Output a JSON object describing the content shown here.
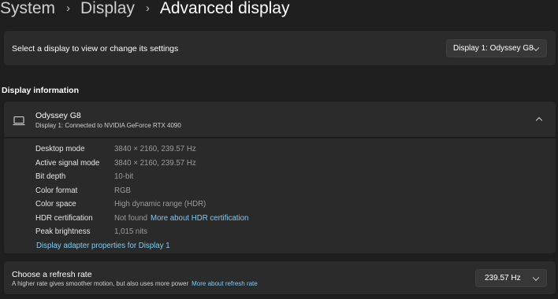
{
  "breadcrumb": {
    "items": [
      "System",
      "Display",
      "Advanced display"
    ]
  },
  "display_selector": {
    "label": "Select a display to view or change its settings",
    "selected": "Display 1: Odyssey G8"
  },
  "display_information": {
    "section_title": "Display information",
    "monitor_name": "Odyssey G8",
    "connection": "Display 1: Connected to NVIDIA GeForce RTX 4090",
    "rows": [
      {
        "key": "Desktop mode",
        "value": "3840 × 2160, 239.57 Hz"
      },
      {
        "key": "Active signal mode",
        "value": "3840 × 2160, 239.57 Hz"
      },
      {
        "key": "Bit depth",
        "value": "10-bit"
      },
      {
        "key": "Color format",
        "value": "RGB"
      },
      {
        "key": "Color space",
        "value": "High dynamic range (HDR)"
      },
      {
        "key": "HDR certification",
        "value": "Not found",
        "link": "More about HDR certification"
      },
      {
        "key": "Peak brightness",
        "value": "1,015 nits"
      }
    ],
    "adapter_link": "Display adapter properties for Display 1"
  },
  "refresh_rate": {
    "title": "Choose a refresh rate",
    "description": "A higher rate gives smoother motion, but also uses more power",
    "link": "More about refresh rate",
    "selected": "239.57 Hz"
  },
  "icons": {
    "breadcrumb_separator": "chevron-right-icon",
    "monitor": "laptop-icon",
    "expand": "chevron-up-icon",
    "dropdown": "chevron-down-icon"
  },
  "colors": {
    "background": "#1f1f1f",
    "card": "#2b2b2b",
    "link": "#7fcdf0"
  }
}
